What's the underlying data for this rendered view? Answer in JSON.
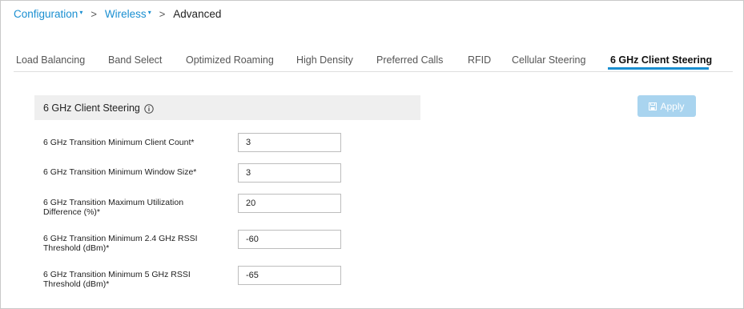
{
  "breadcrumb": {
    "items": [
      "Configuration",
      "Wireless"
    ],
    "caret": "▾",
    "separator": ">",
    "current": "Advanced"
  },
  "tabs": [
    {
      "label": "Load Balancing",
      "active": false
    },
    {
      "label": "Band Select",
      "active": false
    },
    {
      "label": "Optimized Roaming",
      "active": false
    },
    {
      "label": "High Density",
      "active": false
    },
    {
      "label": "Preferred Calls",
      "active": false
    },
    {
      "label": "RFID",
      "active": false
    },
    {
      "label": "Cellular Steering",
      "active": false
    },
    {
      "label": "6 GHz Client Steering",
      "active": true
    }
  ],
  "section": {
    "title": "6 GHz Client Steering",
    "info_icon": "info-circle-icon"
  },
  "apply_button": {
    "label": "Apply",
    "icon": "save-icon",
    "enabled": false
  },
  "form": {
    "fields": [
      {
        "label": "6 GHz Transition Minimum Client Count*",
        "value": "3"
      },
      {
        "label": "6 GHz Transition Minimum Window Size*",
        "value": "3"
      },
      {
        "label": "6 GHz Transition Maximum Utilization Difference (%)*",
        "value": "20"
      },
      {
        "label": "6 GHz Transition Minimum 2.4 GHz RSSI Threshold (dBm)*",
        "value": "-60"
      },
      {
        "label": "6 GHz Transition Minimum 5 GHz RSSI Threshold (dBm)*",
        "value": "-65"
      }
    ]
  },
  "colors": {
    "link": "#1a8fd1",
    "active_tab_underline": "#1a8fd1",
    "apply_disabled": "#a9d4ef",
    "section_bg": "#efefef"
  }
}
